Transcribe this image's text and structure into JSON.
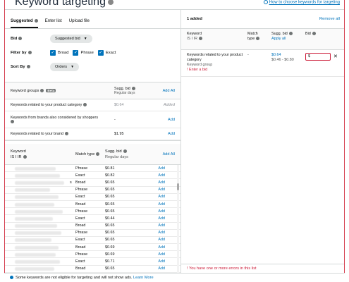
{
  "header": {
    "title": "Keyword targeting",
    "help_link": "How to choose keywords for targeting"
  },
  "tabs": [
    {
      "label": "Suggested",
      "active": true
    },
    {
      "label": "Enter list",
      "active": false
    },
    {
      "label": "Upload file",
      "active": false
    }
  ],
  "filters": {
    "bid_label": "Bid",
    "bid_value": "Suggested bid",
    "filter_label": "Filter by",
    "match_types": [
      {
        "label": "Broad",
        "checked": true
      },
      {
        "label": "Phrase",
        "checked": true
      },
      {
        "label": "Exact",
        "checked": true
      }
    ],
    "sort_label": "Sort By",
    "sort_value": "Orders"
  },
  "keyword_groups": {
    "title": "Keyword groups",
    "badge": "Beta",
    "sugg_bid_header": "Sugg. bid",
    "sugg_bid_sub": "Regular days",
    "add_all": "Add All",
    "rows": [
      {
        "name": "Keywords related to your product category",
        "bid": "$0.64",
        "action": "Added"
      },
      {
        "name": "Keywords from brands also considered by shoppers",
        "bid": "-",
        "action": "Add"
      },
      {
        "name": "Keywords related to your brand",
        "bid": "$1.95",
        "action": "Add"
      }
    ]
  },
  "keyword_table": {
    "col_keyword": "Keyword",
    "col_keyword_sub": "IS I IR",
    "col_match": "Match type",
    "col_sugg": "Sugg. bid",
    "col_sugg_sub": "Regular days",
    "add_all": "Add All",
    "rows": [
      {
        "match": "Phrase",
        "bid": "$0.81",
        "action": "Add"
      },
      {
        "match": "Exact",
        "bid": "$0.82",
        "action": "Add"
      },
      {
        "match": "Broad",
        "bid": "$0.65",
        "action": "Add",
        "suffix": "s"
      },
      {
        "match": "Phrase",
        "bid": "$0.65",
        "action": "Add"
      },
      {
        "match": "Exact",
        "bid": "$0.65",
        "action": "Add"
      },
      {
        "match": "Broad",
        "bid": "$0.65",
        "action": "Add"
      },
      {
        "match": "Phrase",
        "bid": "$0.65",
        "action": "Add"
      },
      {
        "match": "Exact",
        "bid": "$0.44",
        "action": "Add"
      },
      {
        "match": "Broad",
        "bid": "$0.65",
        "action": "Add"
      },
      {
        "match": "Phrase",
        "bid": "$0.65",
        "action": "Add"
      },
      {
        "match": "Exact",
        "bid": "$0.65",
        "action": "Add"
      },
      {
        "match": "Broad",
        "bid": "$0.69",
        "action": "Add"
      },
      {
        "match": "Phrase",
        "bid": "$0.69",
        "action": "Add"
      },
      {
        "match": "Exact",
        "bid": "$0.71",
        "action": "Add"
      },
      {
        "match": "Broad",
        "bid": "$0.65",
        "action": "Add"
      },
      {
        "match": "Phrase",
        "bid": "$0.65",
        "action": "Add"
      }
    ]
  },
  "added_panel": {
    "count": "1 added",
    "remove_all": "Remove all",
    "col_keyword": "Keyword",
    "col_keyword_sub": "IS I IR",
    "col_match": "Match type",
    "col_sugg": "Sugg. bid",
    "col_apply": "Apply all",
    "col_bid": "Bid",
    "row": {
      "keyword": "Keywords related to your product category",
      "group_label": "Keyword group",
      "error": "Enter a bid",
      "match": "-",
      "sugg": "$0.64",
      "range": "$0.46 - $0.80",
      "bid_value": "$"
    },
    "error_footer": "You have one or more errors in this list"
  },
  "notice": {
    "text": "Some keywords are not eligible for targeting and will not show ads.",
    "link": "Learn More"
  },
  "colors": {
    "accent": "#0073bb",
    "error": "#cc1c39",
    "frame": "#d53e4f"
  }
}
